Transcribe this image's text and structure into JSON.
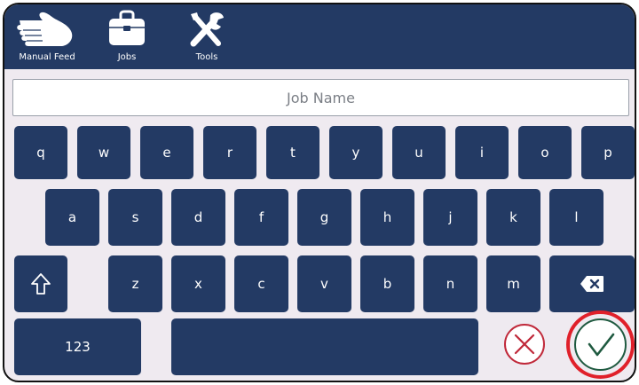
{
  "toolbar": {
    "items": [
      {
        "label": "Manual Feed",
        "icon": "hand-icon"
      },
      {
        "label": "Jobs",
        "icon": "briefcase-icon"
      },
      {
        "label": "Tools",
        "icon": "wrench-screwdriver-icon"
      }
    ]
  },
  "job_name": {
    "placeholder": "Job Name",
    "value": ""
  },
  "keyboard": {
    "row1": [
      "q",
      "w",
      "e",
      "r",
      "t",
      "y",
      "u",
      "i",
      "o",
      "p"
    ],
    "row2": [
      "a",
      "s",
      "d",
      "f",
      "g",
      "h",
      "j",
      "k",
      "l"
    ],
    "row3": [
      "z",
      "x",
      "c",
      "v",
      "b",
      "n",
      "m"
    ],
    "shift_icon": "shift-arrow-icon",
    "backspace_icon": "backspace-icon",
    "mode_key": "123",
    "space_key": ""
  },
  "actions": {
    "cancel_icon": "x-circle-icon",
    "confirm_icon": "check-circle-icon"
  },
  "colors": {
    "primary": "#233a64",
    "background": "#efeaf0",
    "cancel": "#c0293a",
    "confirm": "#1f5a40",
    "highlight": "#e0202a"
  }
}
